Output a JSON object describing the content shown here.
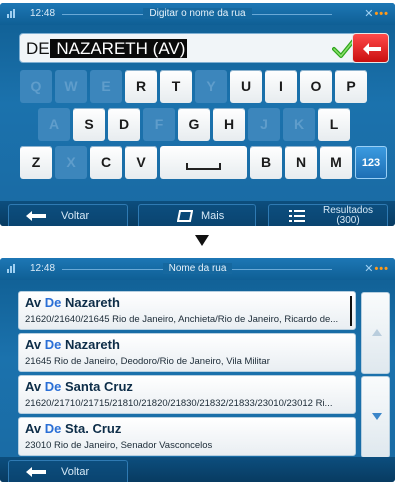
{
  "screen1": {
    "status": {
      "time": "12:48",
      "title": "Digitar o nome da rua"
    },
    "input": {
      "typed": "DE",
      "selected": " NAZARETH (AV)"
    },
    "keyboard": {
      "row1": [
        {
          "label": "Q",
          "enabled": false
        },
        {
          "label": "W",
          "enabled": false
        },
        {
          "label": "E",
          "enabled": false
        },
        {
          "label": "R",
          "enabled": true
        },
        {
          "label": "T",
          "enabled": true
        },
        {
          "label": "Y",
          "enabled": false
        },
        {
          "label": "U",
          "enabled": true
        },
        {
          "label": "I",
          "enabled": true
        },
        {
          "label": "O",
          "enabled": true
        },
        {
          "label": "P",
          "enabled": true
        }
      ],
      "row2": [
        {
          "label": "A",
          "enabled": false
        },
        {
          "label": "S",
          "enabled": true
        },
        {
          "label": "D",
          "enabled": true
        },
        {
          "label": "F",
          "enabled": false
        },
        {
          "label": "G",
          "enabled": true
        },
        {
          "label": "H",
          "enabled": true
        },
        {
          "label": "J",
          "enabled": false
        },
        {
          "label": "K",
          "enabled": false
        },
        {
          "label": "L",
          "enabled": true
        }
      ],
      "row3": [
        {
          "label": "Z",
          "enabled": true
        },
        {
          "label": "X",
          "enabled": false
        },
        {
          "label": "C",
          "enabled": true
        },
        {
          "label": "V",
          "enabled": true
        },
        {
          "label": "",
          "enabled": true,
          "space": true
        },
        {
          "label": "B",
          "enabled": true
        },
        {
          "label": "N",
          "enabled": true
        },
        {
          "label": "M",
          "enabled": true
        },
        {
          "label": "123",
          "enabled": true,
          "num": true
        }
      ]
    },
    "bottom": {
      "back": "Voltar",
      "more": "Mais",
      "results": "Resultados",
      "results_count": "(300)"
    }
  },
  "screen2": {
    "status": {
      "time": "12:48",
      "title": "Nome da rua"
    },
    "results": [
      {
        "prefix": "Av ",
        "highlight": "De",
        "name": " Nazareth",
        "detail": "21620/21640/21645 Rio de Janeiro, Anchieta/Rio de Janeiro, Ricardo de..."
      },
      {
        "prefix": "Av ",
        "highlight": "De",
        "name": " Nazareth",
        "detail": "21645 Rio de Janeiro, Deodoro/Rio de Janeiro, Vila Militar"
      },
      {
        "prefix": "Av ",
        "highlight": "De",
        "name": " Santa Cruz",
        "detail": "21620/21710/21715/21810/21820/21830/21832/21833/23010/23012 Ri..."
      },
      {
        "prefix": "Av ",
        "highlight": "De",
        "name": " Sta. Cruz",
        "detail": "23010 Rio de Janeiro, Senador Vasconcelos"
      }
    ],
    "bottom": {
      "back": "Voltar"
    }
  },
  "colors": {
    "accent_red": "#e01818",
    "highlight_blue": "#2a6fd6",
    "panel_blue": "#1a6aa3"
  }
}
